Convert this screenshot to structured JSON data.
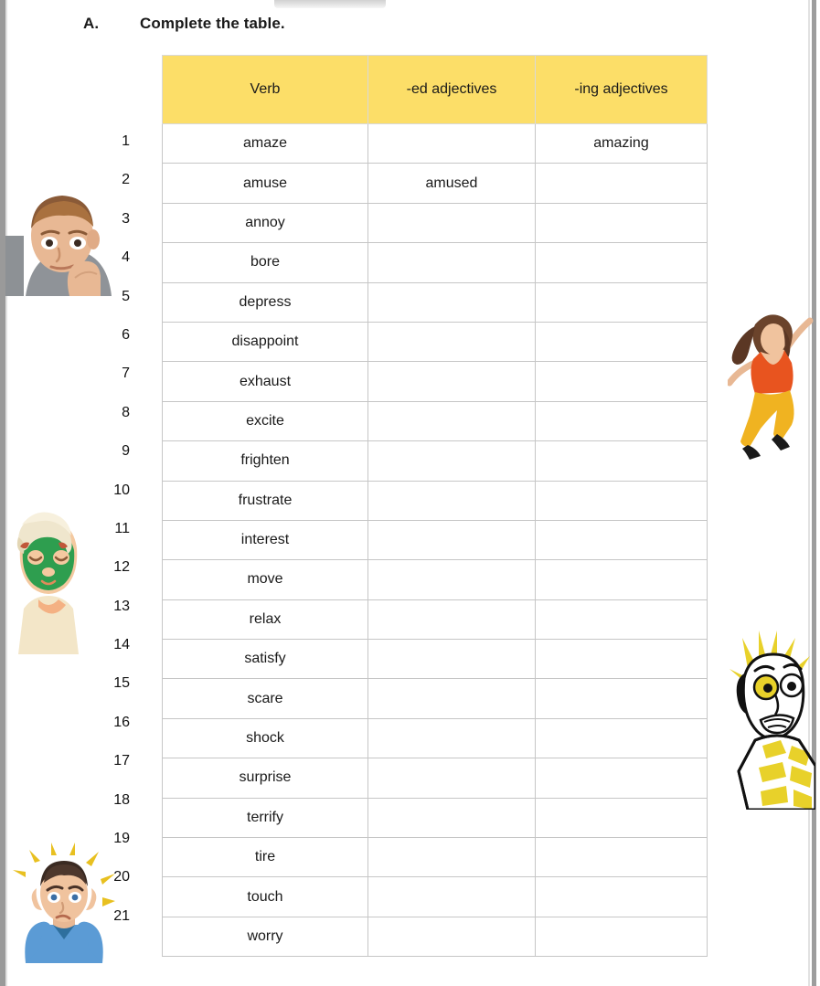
{
  "page": {
    "section_letter": "A.",
    "instruction": "Complete the table."
  },
  "table": {
    "columns": [
      "Verb",
      "-ed adjectives",
      "-ing adjectives"
    ],
    "header_color": "#FCDE68",
    "border_color": "#c6c6c6",
    "rows": [
      {
        "number": "1",
        "verb": "amaze",
        "ed": "",
        "ing": "amazing"
      },
      {
        "number": "2",
        "verb": "amuse",
        "ed": "amused",
        "ing": ""
      },
      {
        "number": "3",
        "verb": "annoy",
        "ed": "",
        "ing": ""
      },
      {
        "number": "4",
        "verb": "bore",
        "ed": "",
        "ing": ""
      },
      {
        "number": "5",
        "verb": "depress",
        "ed": "",
        "ing": ""
      },
      {
        "number": "6",
        "verb": "disappoint",
        "ed": "",
        "ing": ""
      },
      {
        "number": "7",
        "verb": "exhaust",
        "ed": "",
        "ing": ""
      },
      {
        "number": "8",
        "verb": "excite",
        "ed": "",
        "ing": ""
      },
      {
        "number": "9",
        "verb": "frighten",
        "ed": "",
        "ing": ""
      },
      {
        "number": "10",
        "verb": "frustrate",
        "ed": "",
        "ing": ""
      },
      {
        "number": "11",
        "verb": "interest",
        "ed": "",
        "ing": ""
      },
      {
        "number": "12",
        "verb": "move",
        "ed": "",
        "ing": ""
      },
      {
        "number": "13",
        "verb": "relax",
        "ed": "",
        "ing": ""
      },
      {
        "number": "14",
        "verb": "satisfy",
        "ed": "",
        "ing": ""
      },
      {
        "number": "15",
        "verb": "scare",
        "ed": "",
        "ing": ""
      },
      {
        "number": "16",
        "verb": "shock",
        "ed": "",
        "ing": ""
      },
      {
        "number": "17",
        "verb": "surprise",
        "ed": "",
        "ing": ""
      },
      {
        "number": "18",
        "verb": "terrify",
        "ed": "",
        "ing": ""
      },
      {
        "number": "19",
        "verb": "tire",
        "ed": "",
        "ing": ""
      },
      {
        "number": "20",
        "verb": "touch",
        "ed": "",
        "ing": ""
      },
      {
        "number": "21",
        "verb": "worry",
        "ed": "",
        "ing": ""
      }
    ]
  },
  "illustrations": [
    {
      "id": "fig-bored",
      "name": "bored-man-illustration",
      "description": "Bored man resting his chin on his hand"
    },
    {
      "id": "fig-excite",
      "name": "excited-woman-illustration",
      "description": "Excited woman jumping in the air"
    },
    {
      "id": "fig-relax",
      "name": "relaxed-woman-illustration",
      "description": "Relaxed woman with green face mask and towel"
    },
    {
      "id": "fig-terror",
      "name": "terrified-man-illustration",
      "description": "Terrified man with spiky hair and wide eyes"
    },
    {
      "id": "fig-worry",
      "name": "worried-man-illustration",
      "description": "Worried man holding his head"
    }
  ]
}
